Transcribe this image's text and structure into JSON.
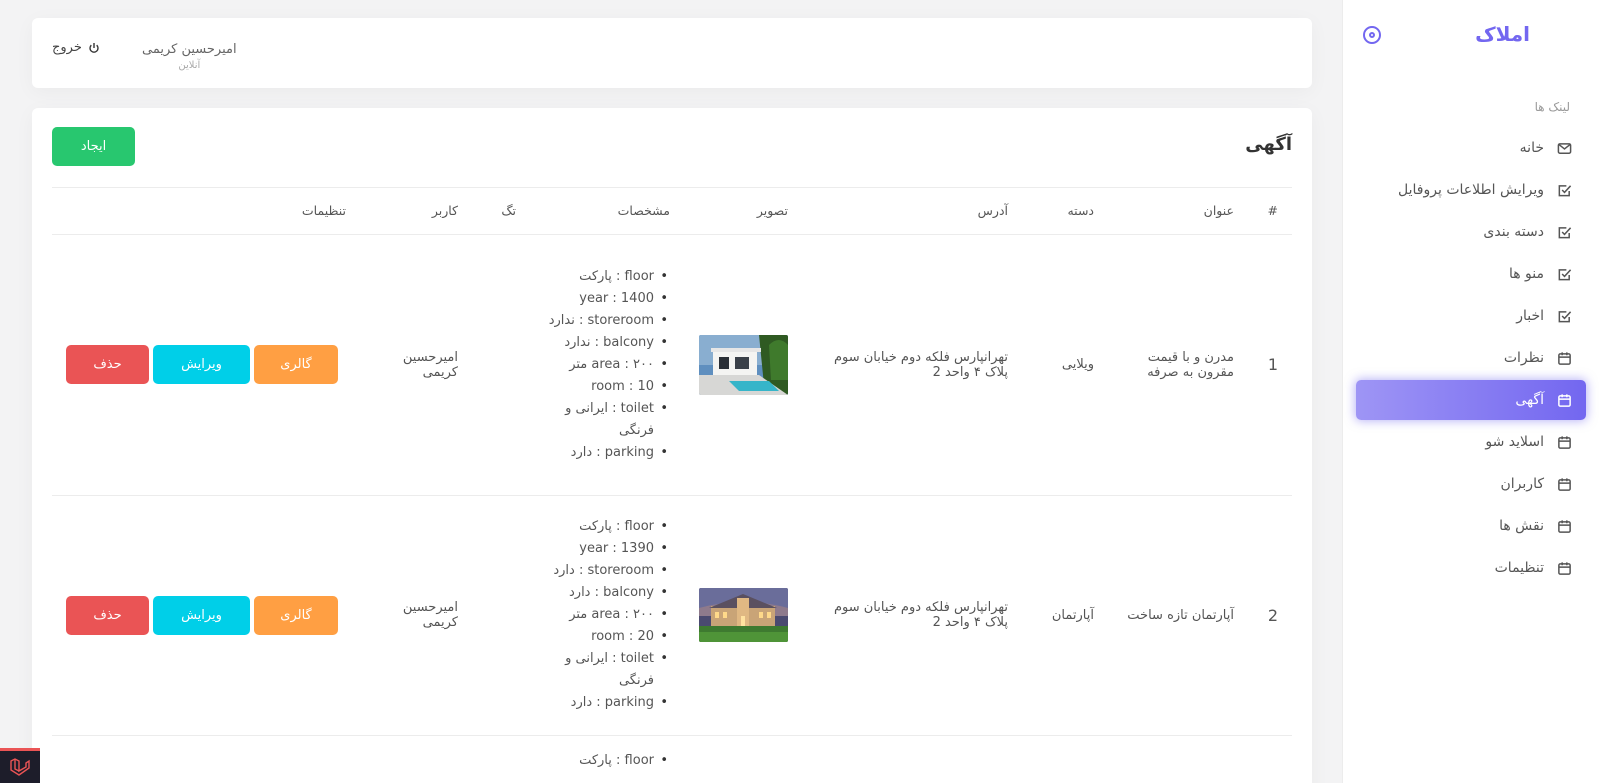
{
  "brand": {
    "name": "املاک"
  },
  "sidebar": {
    "header": "لینک ها",
    "items": [
      {
        "label": "خانه",
        "icon": "mail-icon",
        "active": false
      },
      {
        "label": "ویرایش اطلاعات پروفایل",
        "icon": "check-square-icon",
        "active": false
      },
      {
        "label": "دسته بندی",
        "icon": "check-square-icon",
        "active": false
      },
      {
        "label": "منو ها",
        "icon": "check-square-icon",
        "active": false
      },
      {
        "label": "اخبار",
        "icon": "check-square-icon",
        "active": false
      },
      {
        "label": "نظرات",
        "icon": "calendar-icon",
        "active": false
      },
      {
        "label": "آگهی",
        "icon": "calendar-icon",
        "active": true
      },
      {
        "label": "اسلاید شو",
        "icon": "calendar-icon",
        "active": false
      },
      {
        "label": "کاربران",
        "icon": "calendar-icon",
        "active": false
      },
      {
        "label": "نقش ها",
        "icon": "calendar-icon",
        "active": false
      },
      {
        "label": "تنظیمات",
        "icon": "calendar-icon",
        "active": false
      }
    ]
  },
  "topbar": {
    "logout_label": "خروج",
    "user_name": "امیرحسین کریمی",
    "user_status": "آنلاین"
  },
  "card": {
    "title": "آگهی",
    "create_label": "ایجاد"
  },
  "table": {
    "headers": {
      "num": "#",
      "title": "عنوان",
      "category": "دسته",
      "address": "آدرس",
      "image": "تصویر",
      "specs": "مشخصات",
      "tag": "تگ",
      "user": "کاربر",
      "settings": "تنظیمات"
    },
    "rows": [
      {
        "num": "1",
        "title": "مدرن و با قیمت مقرون به صرفه",
        "category": "ویلایی",
        "address": "تهرانپارس فلکه دوم خیابان سوم پلاک ۴ واحد 2",
        "specs": [
          "floor : پارکت",
          "year : 1400",
          "storeroom : ندارد",
          "balcony : ندارد",
          "area : ۲۰۰ متر",
          "room : 10",
          "toilet : ایرانی و فرنگی",
          "parking : دارد"
        ],
        "tag": "",
        "user": "امیرحسین کریمی",
        "gallery_label": "گالری",
        "edit_label": "ویرایش",
        "delete_label": "حذف"
      },
      {
        "num": "2",
        "title": "آپارتمان تازه ساخت",
        "category": "آپارتمان",
        "address": "تهرانپارس فلکه دوم خیابان سوم پلاک ۴ واحد 2",
        "specs": [
          "floor : پارکت",
          "year : 1390",
          "storeroom : دارد",
          "balcony : دارد",
          "area : ۲۰۰ متر",
          "room : 20",
          "toilet : ایرانی و فرنگی",
          "parking : دارد"
        ],
        "tag": "",
        "user": "امیرحسین کریمی",
        "gallery_label": "گالری",
        "edit_label": "ویرایش",
        "delete_label": "حذف"
      },
      {
        "specs": [
          "floor : پارکت"
        ]
      }
    ]
  },
  "colors": {
    "primary": "#7367f0",
    "success": "#28c76f",
    "danger": "#ea5455",
    "info": "#00cfe8",
    "warning": "#ff9f43"
  }
}
